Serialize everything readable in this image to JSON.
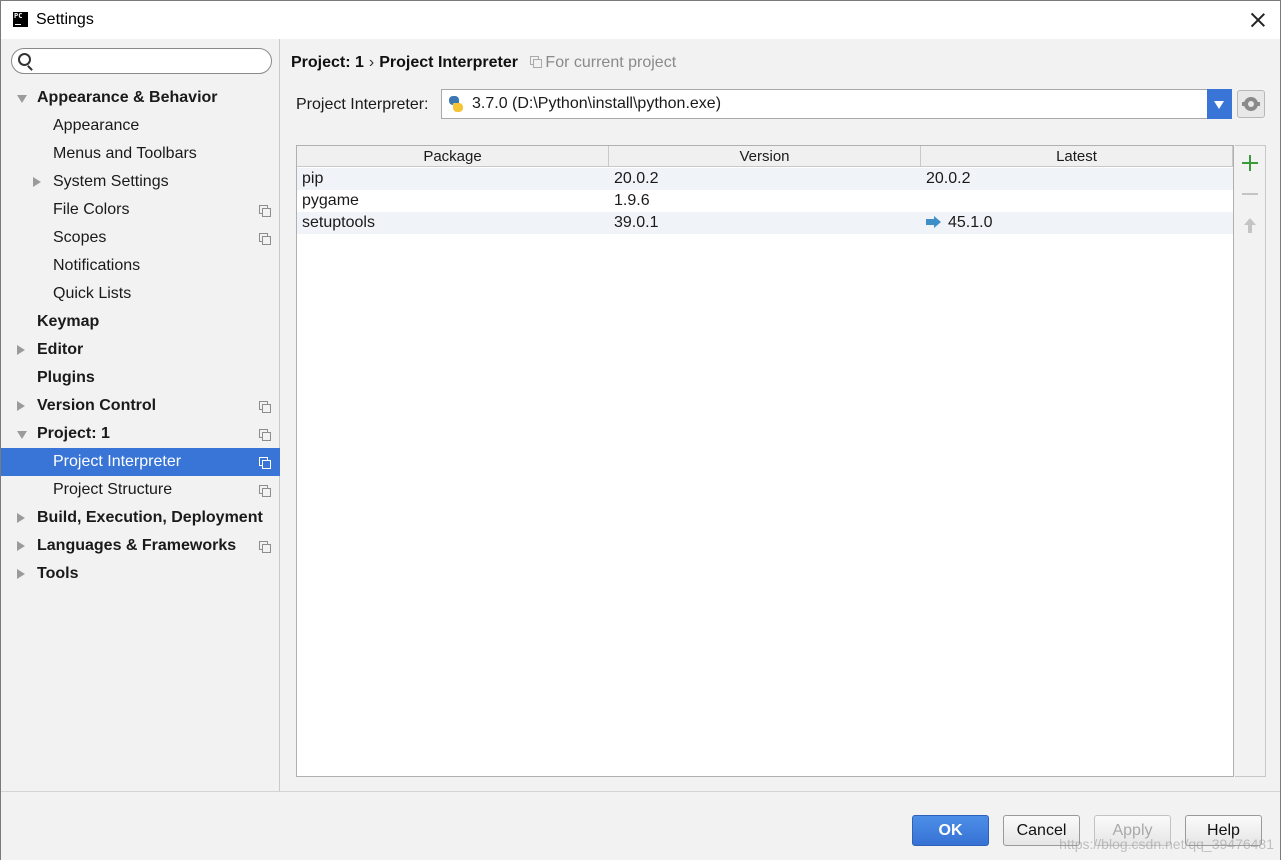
{
  "window": {
    "title": "Settings"
  },
  "search": {
    "placeholder": "",
    "value": ""
  },
  "sidebar": {
    "items": [
      {
        "label": "Appearance & Behavior",
        "bold": true,
        "expander": "down",
        "indent": 0,
        "copy": false
      },
      {
        "label": "Appearance",
        "bold": false,
        "expander": "none",
        "indent": 1,
        "copy": false
      },
      {
        "label": "Menus and Toolbars",
        "bold": false,
        "expander": "none",
        "indent": 1,
        "copy": false
      },
      {
        "label": "System Settings",
        "bold": false,
        "expander": "right",
        "indent": 1,
        "copy": false
      },
      {
        "label": "File Colors",
        "bold": false,
        "expander": "none",
        "indent": 1,
        "copy": true
      },
      {
        "label": "Scopes",
        "bold": false,
        "expander": "none",
        "indent": 1,
        "copy": true
      },
      {
        "label": "Notifications",
        "bold": false,
        "expander": "none",
        "indent": 1,
        "copy": false
      },
      {
        "label": "Quick Lists",
        "bold": false,
        "expander": "none",
        "indent": 1,
        "copy": false
      },
      {
        "label": "Keymap",
        "bold": true,
        "expander": "none",
        "indent": 0,
        "copy": false
      },
      {
        "label": "Editor",
        "bold": true,
        "expander": "right",
        "indent": 0,
        "copy": false
      },
      {
        "label": "Plugins",
        "bold": true,
        "expander": "none",
        "indent": 0,
        "copy": false
      },
      {
        "label": "Version Control",
        "bold": true,
        "expander": "right",
        "indent": 0,
        "copy": true
      },
      {
        "label": "Project: 1",
        "bold": true,
        "expander": "down",
        "indent": 0,
        "copy": true
      },
      {
        "label": "Project Interpreter",
        "bold": false,
        "expander": "none",
        "indent": 1,
        "copy": true,
        "selected": true
      },
      {
        "label": "Project Structure",
        "bold": false,
        "expander": "none",
        "indent": 1,
        "copy": true
      },
      {
        "label": "Build, Execution, Deployment",
        "bold": true,
        "expander": "right",
        "indent": 0,
        "copy": false
      },
      {
        "label": "Languages & Frameworks",
        "bold": true,
        "expander": "right",
        "indent": 0,
        "copy": true
      },
      {
        "label": "Tools",
        "bold": true,
        "expander": "right",
        "indent": 0,
        "copy": false
      }
    ]
  },
  "breadcrumb": {
    "parent": "Project: 1",
    "separator": "›",
    "current": "Project Interpreter",
    "note": "For current project"
  },
  "interpreter": {
    "label": "Project Interpreter:",
    "value": "3.7.0 (D:\\Python\\install\\python.exe)"
  },
  "packages": {
    "columns": [
      "Package",
      "Version",
      "Latest"
    ],
    "rows": [
      {
        "package": "pip",
        "version": "20.0.2",
        "latest": "20.0.2",
        "upgrade": false
      },
      {
        "package": "pygame",
        "version": "1.9.6",
        "latest": "",
        "upgrade": false
      },
      {
        "package": "setuptools",
        "version": "39.0.1",
        "latest": "45.1.0",
        "upgrade": true
      }
    ]
  },
  "buttons": {
    "ok": "OK",
    "cancel": "Cancel",
    "apply": "Apply",
    "help": "Help"
  },
  "watermark": "https://blog.csdn.net/qq_39476481",
  "colors": {
    "selection": "#3875d7",
    "upgrade_arrow": "#3e8fc8",
    "add_icon": "#3a9a3a"
  }
}
